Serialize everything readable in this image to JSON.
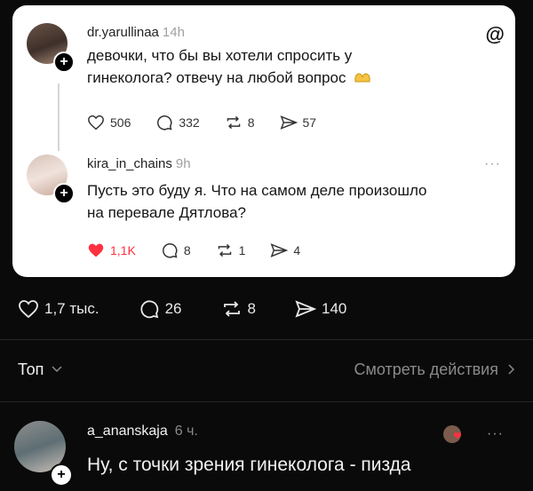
{
  "quoted_card": {
    "post1": {
      "username": "dr.yarullinaa",
      "time": "14h",
      "line1": "девочки, что бы вы хотели спросить у",
      "line2": "гинеколога? отвечу на любой вопрос",
      "likes": "506",
      "comments": "332",
      "reposts": "8",
      "shares": "57"
    },
    "post2": {
      "username": "kira_in_chains",
      "time": "9h",
      "more": "···",
      "line1": "Пусть это буду я. Что на самом деле произошло",
      "line2": "на перевале Дятлова?",
      "likes": "1,1K",
      "comments": "8",
      "reposts": "1",
      "shares": "4"
    },
    "logo": "@"
  },
  "stats": {
    "likes": "1,7 тыс.",
    "comments": "26",
    "reposts": "8",
    "shares": "140"
  },
  "sort": {
    "label": "Топ",
    "see_actions": "Смотреть действия"
  },
  "comment": {
    "username": "a_ananskaja",
    "time": "6 ч.",
    "more": "···",
    "text": "Ну, с точки зрения гинеколога - пизда"
  },
  "colors": {
    "like_red": "#ff3040",
    "background": "#0a0a0a"
  }
}
